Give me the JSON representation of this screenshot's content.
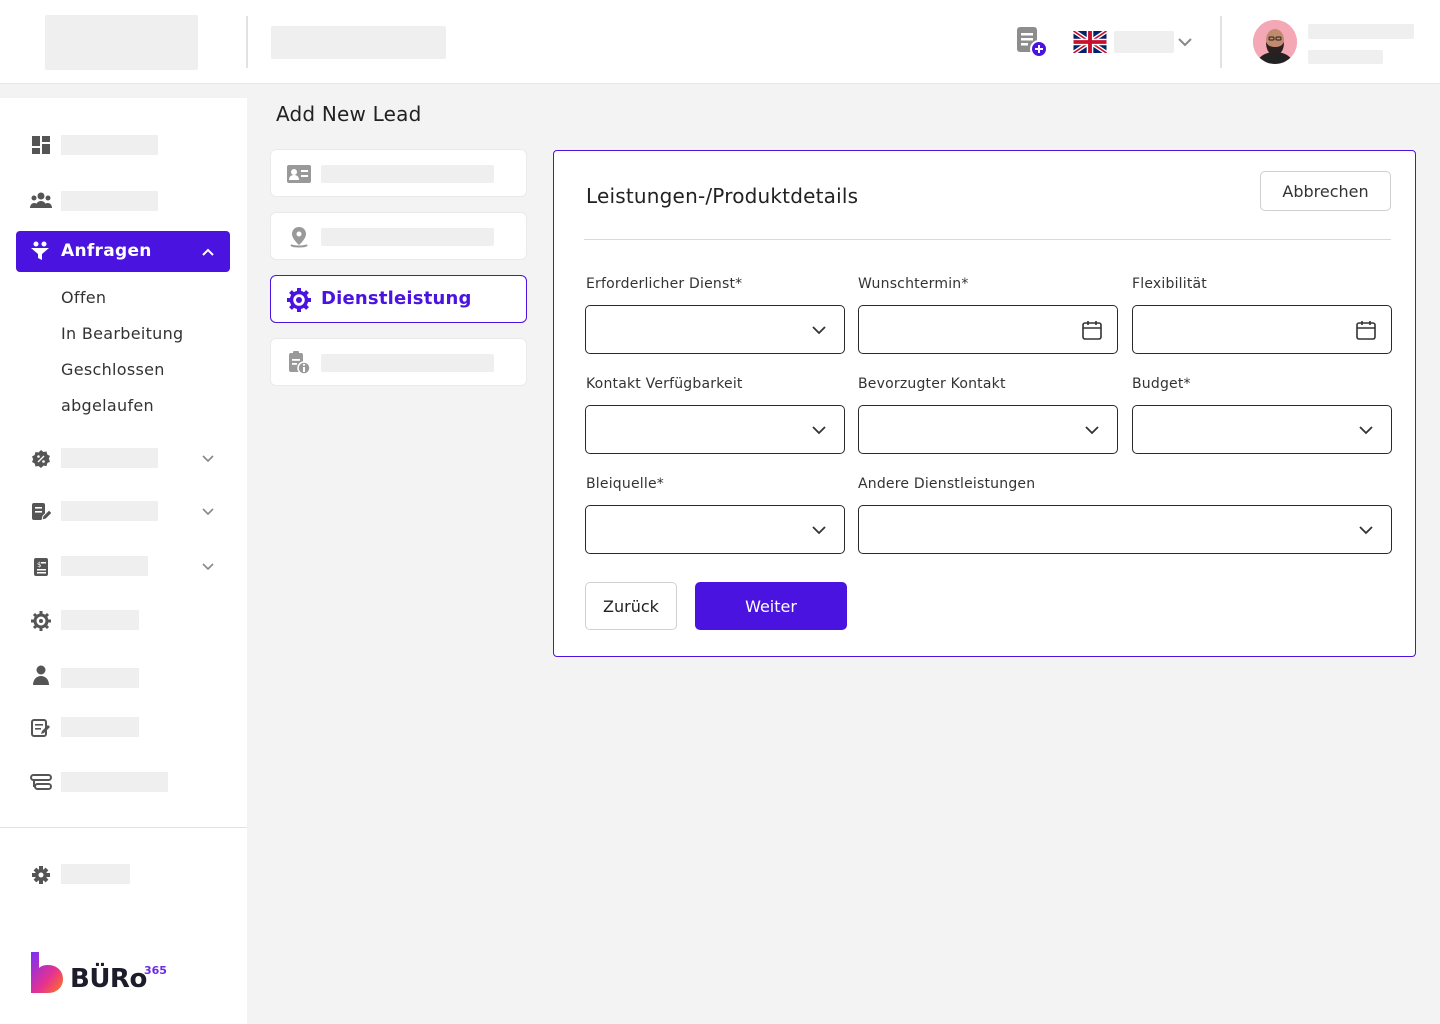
{
  "colors": {
    "accent": "#4a13e0",
    "placeholder": "#efefef",
    "background": "#f3f3f3"
  },
  "topbar": {
    "add_doc_icon": "document-add-icon",
    "language_flag": "uk-flag-icon",
    "language_chevron": "chevron-down-icon"
  },
  "sidebar": {
    "active_item": {
      "label": "Anfragen",
      "icon": "funnel-icon"
    },
    "sub_items": [
      "Offen",
      "In Bearbeitung",
      "Geschlossen",
      "abgelaufen"
    ],
    "icons": [
      "dashboard-icon",
      "team-icon",
      "percent-badge-icon",
      "edit-document-icon",
      "invoice-icon",
      "settings-gear-icon",
      "user-icon",
      "notes-icon",
      "integration-icon",
      "settings-icon"
    ]
  },
  "brand": {
    "name": "BÜRo",
    "suffix": "365"
  },
  "page": {
    "title": "Add New Lead"
  },
  "steps": {
    "active_label": "Dienstleistung"
  },
  "form": {
    "title": "Leistungen-/Produktdetails",
    "cancel_label": "Abbrechen",
    "fields": {
      "required_service": "Erforderlicher Dienst*",
      "preferred_date": "Wunschtermin*",
      "flexibility": "Flexibilität",
      "contact_availability": "Kontakt Verfügbarkeit",
      "preferred_contact": "Bevorzugter Kontakt",
      "budget": "Budget*",
      "lead_source": "Bleiquelle*",
      "other_services": "Andere Dienstleistungen"
    },
    "back_label": "Zurück",
    "next_label": "Weiter"
  }
}
